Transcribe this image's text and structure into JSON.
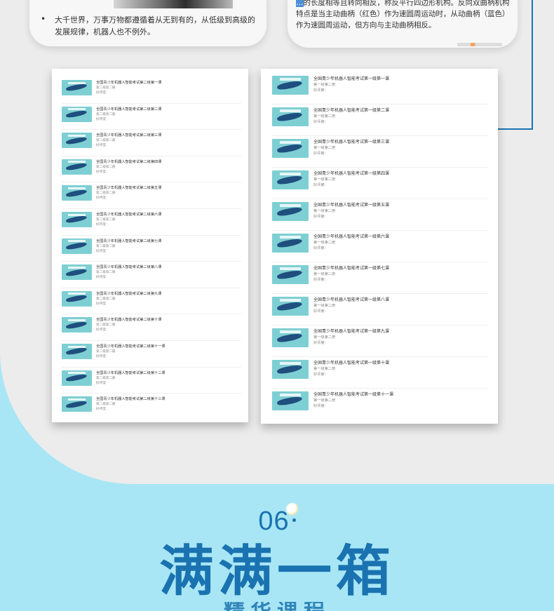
{
  "previous": {
    "left_bullet": "大千世界，万事万物都遵循着从无到有的，从低级到高级的发展规律，机器人也不例外。",
    "right_text_highlight": "…",
    "right_text": "的长度相等且转向相反，称反平行四边形机构。反向双曲柄机构特点是当主动曲柄（红色）作为速圆周运动时，从动曲柄（蓝色）作为速圆周运动，但方向与主动曲柄相反。"
  },
  "left_panel": {
    "items": [
      {
        "title": "全国青少年机器人智能考试第二级第一课",
        "sub1": "第二级第二册",
        "sub2": "好评度："
      },
      {
        "title": "全国青少年机器人智能考试第二级第二课",
        "sub1": "第二级第二册",
        "sub2": "好评度："
      },
      {
        "title": "全国青少年机器人智能考试第二级第三课",
        "sub1": "第二级第二册",
        "sub2": "好评度："
      },
      {
        "title": "全国青少年机器人智能考试第二级第四课",
        "sub1": "第二级第二册",
        "sub2": "好评度："
      },
      {
        "title": "全国青少年机器人智能考试第二级第五课",
        "sub1": "第二级第二册",
        "sub2": "好评度："
      },
      {
        "title": "全国青少年机器人智能考试第二级第六课",
        "sub1": "第二级第二册",
        "sub2": "好评度："
      },
      {
        "title": "全国青少年机器人智能考试第二级第七课",
        "sub1": "第二级第二册",
        "sub2": "好评度："
      },
      {
        "title": "全国青少年机器人智能考试第二级第八课",
        "sub1": "第二级第二册",
        "sub2": "好评度："
      },
      {
        "title": "全国青少年机器人智能考试第二级第九课",
        "sub1": "第二级第二册",
        "sub2": "好评度："
      },
      {
        "title": "全国青少年机器人智能考试第二级第十课",
        "sub1": "第二级第二册",
        "sub2": "好评度："
      },
      {
        "title": "全国青少年机器人智能考试第二级第十一课",
        "sub1": "第二级第二册",
        "sub2": "好评度："
      },
      {
        "title": "全国青少年机器人智能考试第二级第十二课",
        "sub1": "第二级第二册",
        "sub2": "好评度："
      },
      {
        "title": "全国青少年机器人智能考试第二级第十三课",
        "sub1": "第二级第二册",
        "sub2": "好评度："
      }
    ]
  },
  "right_panel": {
    "items": [
      {
        "title": "全国青少年机器人智能考试第一级第一课",
        "sub1": "第一级第二册",
        "sub2": "好评度："
      },
      {
        "title": "全国青少年机器人智能考试第一级第二课",
        "sub1": "第一级第二册",
        "sub2": "好评度："
      },
      {
        "title": "全国青少年机器人智能考试第一级第三课",
        "sub1": "第一级第二册",
        "sub2": "好评度："
      },
      {
        "title": "全国青少年机器人智能考试第一级第四课",
        "sub1": "第一级第二册",
        "sub2": "好评度："
      },
      {
        "title": "全国青少年机器人智能考试第一级第五课",
        "sub1": "第一级第二册",
        "sub2": "好评度："
      },
      {
        "title": "全国青少年机器人智能考试第一级第六课",
        "sub1": "第一级第二册",
        "sub2": "好评度："
      },
      {
        "title": "全国青少年机器人智能考试第一级第七课",
        "sub1": "第一级第二册",
        "sub2": "好评度："
      },
      {
        "title": "全国青少年机器人智能考试第一级第八课",
        "sub1": "第一级第二册",
        "sub2": "好评度："
      },
      {
        "title": "全国青少年机器人智能考试第一级第九课",
        "sub1": "第一级第二册",
        "sub2": "好评度："
      },
      {
        "title": "全国青少年机器人智能考试第一级第十课",
        "sub1": "第一级第二册",
        "sub2": "好评度："
      },
      {
        "title": "全国青少年机器人智能考试第一级第十一课",
        "sub1": "第一级第二册",
        "sub2": "好评度："
      }
    ]
  },
  "section": {
    "number": "06",
    "title": "满满一箱",
    "subtitle": "精华课程"
  },
  "colors": {
    "accent": "#1a73b0",
    "background_bottom": "#a9e6f5",
    "background_top": "#ececec",
    "thumb": "#7ecfd3"
  }
}
